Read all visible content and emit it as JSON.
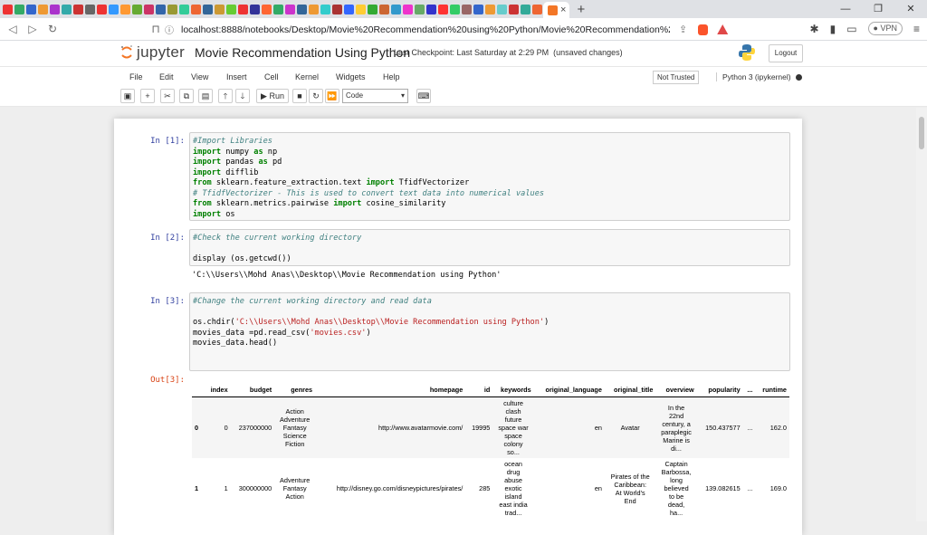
{
  "browser": {
    "tab_close": "×",
    "new_tab": "+",
    "url": "localhost:8888/notebooks/Desktop/Movie%20Recommendation%20using%20Python/Movie%20Recommendation%20Using%20Pyt...",
    "vpn_label": "VPN",
    "window_controls": [
      "—",
      "❐",
      "✕"
    ]
  },
  "header": {
    "logo_text": "jupyter",
    "notebook_title": "Movie Recommendation Using Python",
    "checkpoint": "Last Checkpoint: Last Saturday at 2:29 PM",
    "unsaved": "(unsaved changes)",
    "logout_label": "Logout"
  },
  "menu": {
    "items": [
      "File",
      "Edit",
      "View",
      "Insert",
      "Cell",
      "Kernel",
      "Widgets",
      "Help"
    ],
    "not_trusted": "Not Trusted",
    "kernel_name": "Python 3 (ipykernel)"
  },
  "toolbar": {
    "run_label": "Run",
    "cell_type": "Code"
  },
  "cells": {
    "c1_prompt": "In [1]:",
    "c2_prompt": "In [2]:",
    "c2_output": "'C:\\\\Users\\\\Mohd Anas\\\\Desktop\\\\Movie Recommendation using Python'",
    "c3_prompt": "In [3]:",
    "out3_prompt": "Out[3]:"
  },
  "dataframe": {
    "columns": [
      "",
      "index",
      "budget",
      "genres",
      "homepage",
      "id",
      "keywords",
      "original_language",
      "original_title",
      "overview",
      "popularity",
      "...",
      "runtime"
    ],
    "rows": [
      [
        "0",
        "0",
        "237000000",
        "Action\nAdventure\nFantasy\nScience\nFiction",
        "http://www.avatarmovie.com/",
        "19995",
        "culture\nclash\nfuture\nspace war\nspace\ncolony\nso...",
        "en",
        "Avatar",
        "In the\n22nd\ncentury, a\nparaplegic\nMarine is\ndi...",
        "150.437577",
        "...",
        "162.0"
      ],
      [
        "1",
        "1",
        "300000000",
        "Adventure\nFantasy\nAction",
        "http://disney.go.com/disneypictures/pirates/",
        "285",
        "ocean\ndrug\nabuse\nexotic\nisland\neast india\ntrad...",
        "en",
        "Pirates of the\nCaribbean:\nAt World's\nEnd",
        "Captain\nBarbossa,\nlong\nbelieved\nto be\ndead,\nha...",
        "139.082615",
        "...",
        "169.0"
      ]
    ]
  }
}
